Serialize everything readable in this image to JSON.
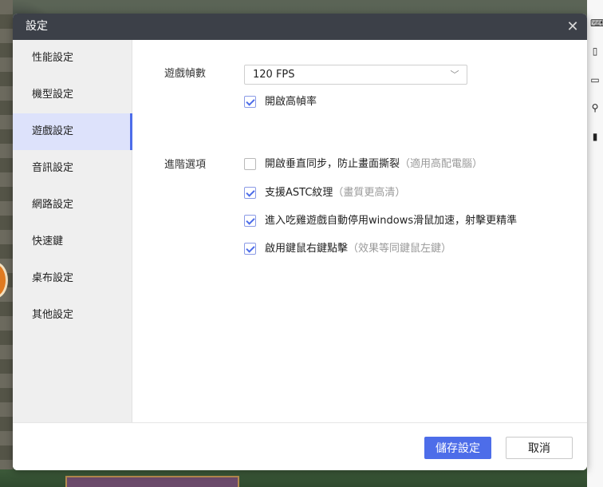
{
  "dialog": {
    "title": "設定",
    "close_icon": "close-icon"
  },
  "sidebar": {
    "items": [
      {
        "label": "性能設定"
      },
      {
        "label": "機型設定"
      },
      {
        "label": "遊戲設定",
        "active": true
      },
      {
        "label": "音訊設定"
      },
      {
        "label": "網路設定"
      },
      {
        "label": "快速鍵"
      },
      {
        "label": "桌布設定"
      },
      {
        "label": "其他設定"
      }
    ]
  },
  "game_settings": {
    "frame_rate": {
      "label": "遊戲幀數",
      "selected": "120 FPS",
      "high_fps": {
        "label": "開啟高幀率",
        "checked": true
      }
    },
    "advanced": {
      "label": "進階選項",
      "options": [
        {
          "label": "開啟垂直同步，防止畫面撕裂",
          "note": "（適用高配電腦）",
          "checked": false
        },
        {
          "label": "支援ASTC紋理",
          "note": "（畫質更高清）",
          "checked": true
        },
        {
          "label": "進入吃雞遊戲自動停用windows滑鼠加速，射擊更精準",
          "note": "",
          "checked": true
        },
        {
          "label": "啟用鍵鼠右鍵點擊",
          "note": "（效果等同鍵鼠左鍵）",
          "checked": true
        }
      ]
    }
  },
  "footer": {
    "save_label": "儲存設定",
    "cancel_label": "取消"
  },
  "colors": {
    "accent": "#4d6de9",
    "titlebar": "#3c4048",
    "sidebar_bg": "#efefef",
    "sidebar_active_bg": "#dde2fb"
  }
}
